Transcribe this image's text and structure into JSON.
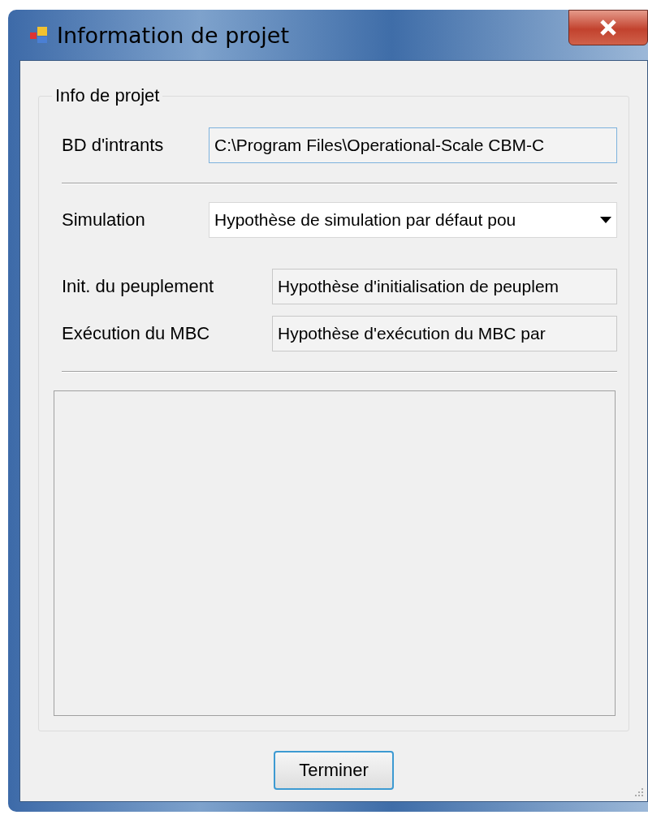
{
  "window": {
    "title": "Information de projet"
  },
  "group": {
    "title": "Info de projet",
    "rows": [
      {
        "kind": "text",
        "label": "BD d'intrants",
        "value": "C:\\Program Files\\Operational-Scale CBM-C",
        "focused": true
      },
      {
        "kind": "separator"
      },
      {
        "kind": "combo",
        "label": "Simulation",
        "value": "Hypothèse de simulation par défaut pou",
        "focused": false
      },
      {
        "kind": "text",
        "label": "Init. du peuplement",
        "value": "Hypothèse d'initialisation de peuplem",
        "focused": false
      },
      {
        "kind": "text",
        "label": "Exécution du MBC",
        "value": "Hypothèse d'exécution du MBC par",
        "focused": false
      },
      {
        "kind": "separator"
      }
    ]
  },
  "buttons": [
    "Terminer"
  ]
}
